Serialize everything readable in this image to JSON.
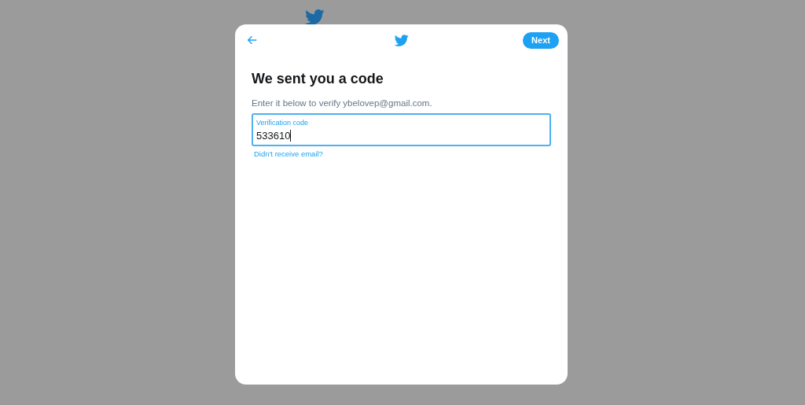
{
  "dialog": {
    "next_button": "Next",
    "title": "We sent you a code",
    "subtitle": "Enter it below to verify ybelovep@gmail.com.",
    "field": {
      "label": "Verification code",
      "value": "533610",
      "focused": true
    },
    "link": "Didn't receive email?"
  }
}
